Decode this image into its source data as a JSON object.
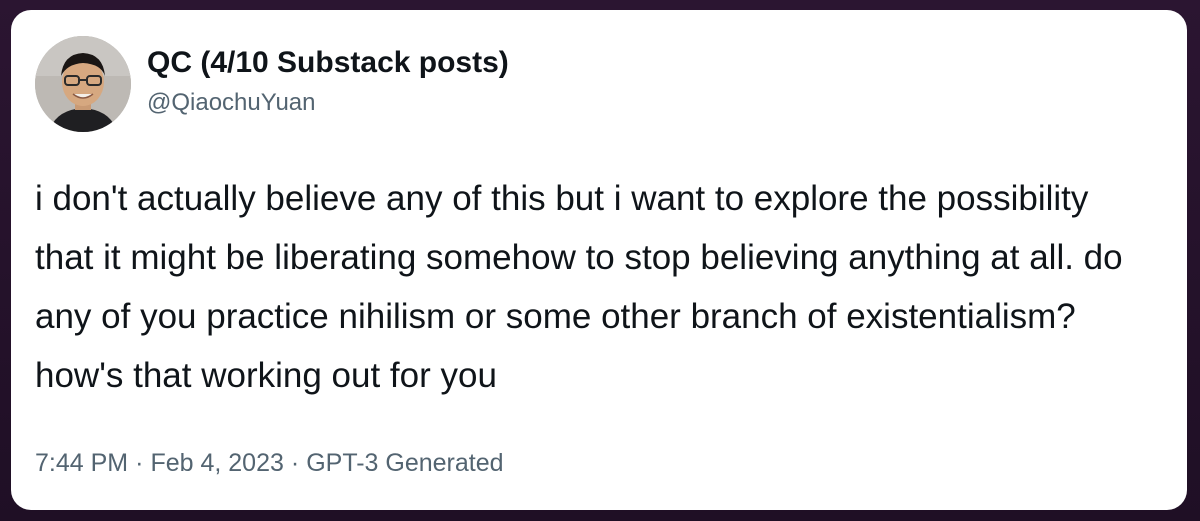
{
  "tweet": {
    "author": {
      "display_name": "QC (4/10 Substack posts)",
      "handle": "@QiaochuYuan",
      "avatar_icon": "profile-photo"
    },
    "text": "i don't actually believe any of this but i want to explore the possibility that it might be liberating somehow to stop believing anything at all. do any of you practice nihilism or some other branch of existentialism? how's that working out for you",
    "time": "7:44 PM",
    "separator": "·",
    "date": "Feb 4, 2023",
    "source": "GPT-3 Generated"
  },
  "colors": {
    "background": "#2a1530",
    "card": "#ffffff",
    "primary_text": "#0f1419",
    "secondary_text": "#536471"
  }
}
